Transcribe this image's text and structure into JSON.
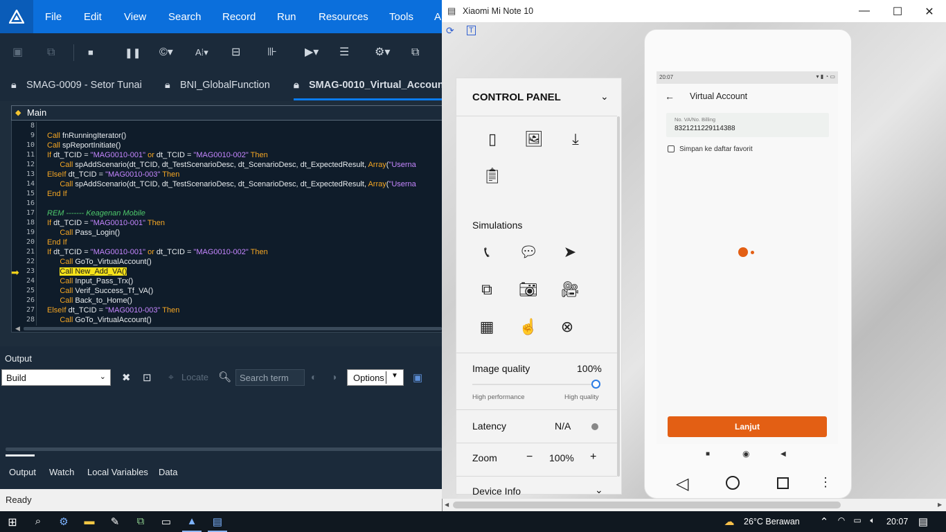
{
  "ide": {
    "menu": [
      "File",
      "Edit",
      "View",
      "Search",
      "Record",
      "Run",
      "Resources",
      "Tools",
      "A"
    ],
    "tabs": [
      "SMAG-0009 - Setor Tunai",
      "BNI_GlobalFunction",
      "SMAG-0010_Virtual_Accoun"
    ],
    "active_tab": 2,
    "editor_selector": "Main",
    "code_lines": [
      {
        "n": "8",
        "html": ""
      },
      {
        "n": "9",
        "html": "<span class='kw'>Call</span> fnRunningIterator()"
      },
      {
        "n": "10",
        "html": "<span class='kw'>Call</span> spReportInitiate()"
      },
      {
        "n": "11",
        "html": "<span class='kw'>If</span> dt_TCID = <span class='st'>\"MAG0010-001\"</span> <span class='kw'>or</span> dt_TCID = <span class='st'>\"MAG0010-002\"</span> <span class='kw'>Then</span>"
      },
      {
        "n": "12",
        "html": "      <span class='kw'>Call</span> spAddScenario(dt_TCID, dt_TestScenarioDesc, dt_ScenarioDesc, dt_ExpectedResult, <span class='kw'>Array</span>(<span class='st'>\"Userna</span>"
      },
      {
        "n": "13",
        "html": "<span class='kw'>ElseIf</span> dt_TCID = <span class='st'>\"MAG0010-003\"</span> <span class='kw'>Then</span>"
      },
      {
        "n": "14",
        "html": "      <span class='kw'>Call</span> spAddScenario(dt_TCID, dt_TestScenarioDesc, dt_ScenarioDesc, dt_ExpectedResult, <span class='kw'>Array</span>(<span class='st'>\"Userna</span>"
      },
      {
        "n": "15",
        "html": "<span class='kw'>End If</span>"
      },
      {
        "n": "16",
        "html": ""
      },
      {
        "n": "17",
        "html": "<span class='cm'>REM ------- Keagenan Mobile</span>"
      },
      {
        "n": "18",
        "html": "<span class='kw'>If</span> dt_TCID = <span class='st'>\"MAG0010-001\"</span> <span class='kw'>Then</span>"
      },
      {
        "n": "19",
        "html": "      <span class='kw'>Call</span> Pass_Login()"
      },
      {
        "n": "20",
        "html": "<span class='kw'>End If</span>"
      },
      {
        "n": "21",
        "html": "<span class='kw'>If</span> dt_TCID = <span class='st'>\"MAG0010-001\"</span> <span class='kw'>or</span> dt_TCID = <span class='st'>\"MAG0010-002\"</span> <span class='kw'>Then</span>"
      },
      {
        "n": "22",
        "html": "      <span class='kw'>Call</span> GoTo_VirtualAccount()"
      },
      {
        "n": "23",
        "html": "      <span class='hl'>Call New_Add_VA()</span>"
      },
      {
        "n": "24",
        "html": "      <span class='kw'>Call</span> Input_Pass_Trx()"
      },
      {
        "n": "25",
        "html": "      <span class='kw'>Call</span> Verif_Success_Tf_VA()"
      },
      {
        "n": "26",
        "html": "      <span class='kw'>Call</span> Back_to_Home()"
      },
      {
        "n": "27",
        "html": "<span class='kw'>ElseIf</span> dt_TCID = <span class='st'>\"MAG0010-003\"</span> <span class='kw'>Then</span>"
      },
      {
        "n": "28",
        "html": "      <span class='kw'>Call</span> GoTo_VirtualAccount()"
      }
    ],
    "output": {
      "title": "Output",
      "build_select": "Build",
      "locate": "Locate",
      "search_placeholder": "Search term",
      "options": "Options"
    },
    "bottom_tabs": [
      "Output",
      "Watch",
      "Local Variables",
      "Data"
    ],
    "status": "Ready"
  },
  "emulator": {
    "title": "Xiaomi Mi Note 10",
    "control_panel": {
      "title": "CONTROL PANEL",
      "simulations": "Simulations",
      "image_quality_label": "Image quality",
      "image_quality_value": "100%",
      "image_quality": 1.0,
      "high_performance": "High performance",
      "high_quality": "High quality",
      "latency_label": "Latency",
      "latency_value": "N/A",
      "zoom_label": "Zoom",
      "zoom_value": "100%",
      "device_info": "Device Info"
    },
    "phone": {
      "status_time": "20:07",
      "screen_title": "Virtual Account",
      "field_label": "No. VA/No. Billing",
      "field_value": "8321211229114388",
      "checkbox_label": "Simpan ke daftar favorit",
      "button": "Lanjut"
    }
  },
  "taskbar": {
    "weather": "26°C  Berawan",
    "clock": "20:07"
  },
  "colors": {
    "menubar": "#0b6fdc",
    "ide_bg": "#1e2d3c",
    "keyword": "#f5a623",
    "string": "#c586ff",
    "accent_orange": "#e35f14"
  }
}
